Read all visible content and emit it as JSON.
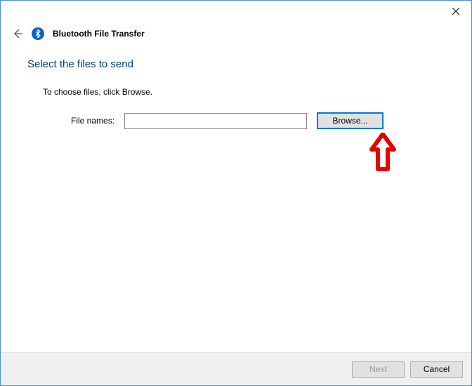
{
  "window": {
    "title": "Bluetooth File Transfer"
  },
  "main": {
    "heading": "Select the files to send",
    "instruction": "To choose files, click Browse.",
    "file_label": "File names:",
    "file_value": "",
    "browse_label": "Browse..."
  },
  "footer": {
    "next_label": "Next",
    "cancel_label": "Cancel"
  }
}
